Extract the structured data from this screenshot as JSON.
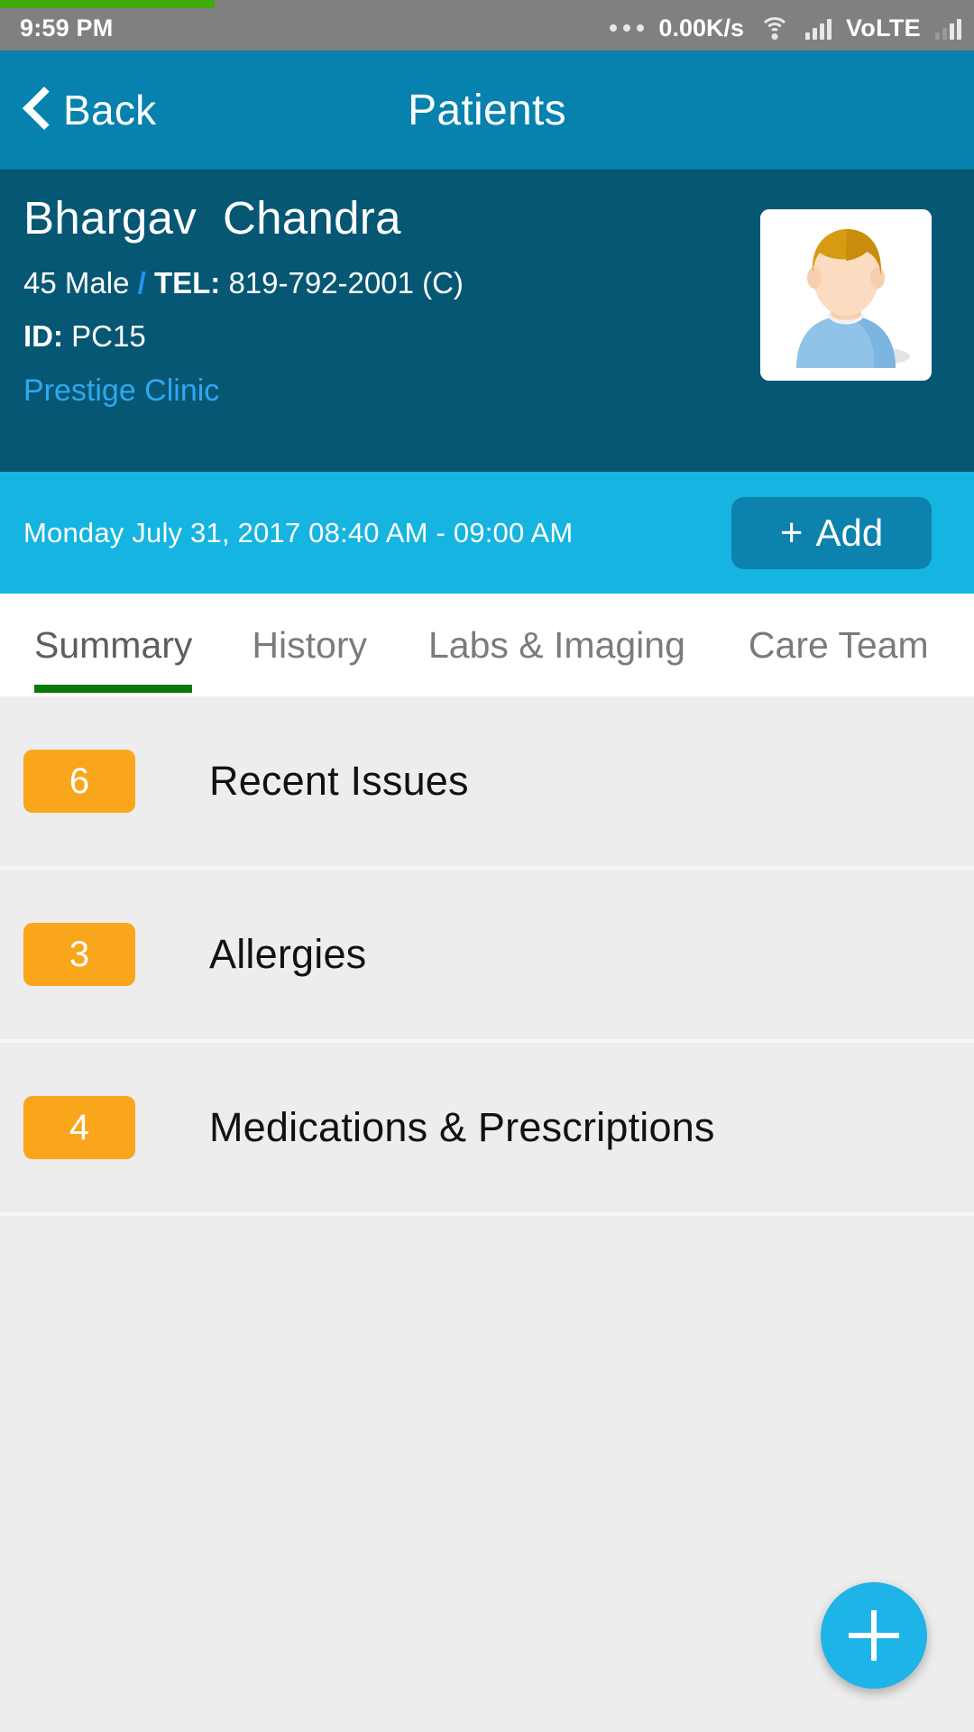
{
  "status_bar": {
    "time": "9:59 PM",
    "overflow_icon": "more-horizontal-icon",
    "net_speed": "0.00K/s",
    "wifi_icon": "wifi-icon",
    "signal_icon": "signal-bars-icon",
    "network_label": "VoLTE",
    "signal2_icon": "signal-bars-icon",
    "progress_percent": 22
  },
  "app_bar": {
    "back_label": "Back",
    "back_icon": "chevron-left-icon",
    "title": "Patients"
  },
  "patient": {
    "name": "Bhargav  Chandra",
    "age": "45",
    "gender": "Male",
    "separator": "/",
    "tel_label": "TEL:",
    "tel_value": "819-792-2001 (C)",
    "id_label": "ID:",
    "id_value": "PC15",
    "clinic": "Prestige Clinic",
    "avatar_icon": "user-avatar-icon"
  },
  "appointment": {
    "datetime": "Monday July 31, 2017 08:40 AM - 09:00 AM",
    "add_label": "Add",
    "add_plus": "+"
  },
  "tabs": [
    {
      "label": "Summary",
      "active": true
    },
    {
      "label": "History",
      "active": false
    },
    {
      "label": "Labs & Imaging",
      "active": false
    },
    {
      "label": "Care Team",
      "active": false
    }
  ],
  "summary_rows": [
    {
      "count": "6",
      "label": "Recent Issues"
    },
    {
      "count": "3",
      "label": "Allergies"
    },
    {
      "count": "4",
      "label": "Medications & Prescriptions"
    }
  ],
  "fab": {
    "icon": "plus-icon"
  },
  "colors": {
    "app_bar": "#0781ad",
    "patient_card": "#065774",
    "appointment_bar": "#16b4e0",
    "accent_badge": "#f9a61c",
    "active_tab_indicator": "#0a7a0a",
    "fab": "#1eb4e8",
    "clinic_link": "#2fa8ef",
    "status_bar": "#808080",
    "progress_fill": "#3faa08",
    "content_bg": "#ededed"
  }
}
